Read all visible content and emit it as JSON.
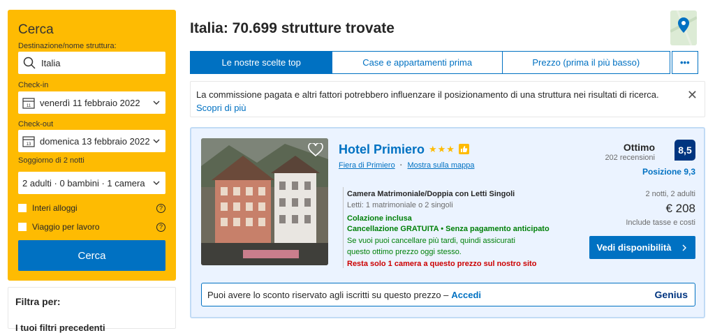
{
  "search": {
    "title": "Cerca",
    "dest_label": "Destinazione/nome struttura:",
    "dest_value": "Italia",
    "checkin_label": "Check-in",
    "checkin_value": "venerdì 11 febbraio 2022",
    "checkin_day": "11",
    "checkout_label": "Check-out",
    "checkout_value": "domenica 13 febbraio 2022",
    "checkout_day": "13",
    "nights_label": "Soggiorno di 2 notti",
    "guests_value": "2 adulti · 0 bambini · 1 camera",
    "opt_entire": "Interi alloggi",
    "opt_business": "Viaggio per lavoro",
    "button": "Cerca"
  },
  "filters": {
    "title": "Filtra per:",
    "subtitle": "I tuoi filtri precedenti"
  },
  "results": {
    "title": "Italia: 70.699 strutture trovate"
  },
  "sort_tabs": [
    {
      "label": "Le nostre scelte top"
    },
    {
      "label": "Case e appartamenti prima"
    },
    {
      "label": "Prezzo (prima il più basso)"
    },
    {
      "label": "•••"
    }
  ],
  "notice": {
    "text": "La commissione pagata e altri fattori potrebbero influenzare il posizionamento di una struttura nei risultati di ricerca.",
    "link": "Scopri di più",
    "close": "✕"
  },
  "hotel": {
    "name": "Hotel Primiero",
    "stars": "★★★",
    "location": "Fiera di Primiero",
    "sep": "·",
    "map_link": "Mostra sulla mappa",
    "rating_word": "Ottimo",
    "reviews": "202 recensioni",
    "score": "8,5",
    "position": "Posizione 9,3",
    "room": "Camera Matrimoniale/Doppia con Letti Singoli",
    "beds": "Letti: 1 matrimoniale o 2 singoli",
    "breakfast": "Colazione inclusa",
    "cancel": "Cancellazione GRATUITA • Senza pagamento anticipato",
    "cancel_note": "Se vuoi puoi cancellare più tardi, quindi assicurati questo ottimo prezzo oggi stesso.",
    "scarcity": "Resta solo 1 camera a questo prezzo sul nostro sito",
    "stay": "2 notti, 2 adulti",
    "price": "€ 208",
    "taxes": "Include tasse e costi",
    "cta": "Vedi disponibilità",
    "genius_text": "Puoi avere lo sconto riservato agli iscritti su questo prezzo –",
    "genius_link": "Accedi",
    "genius_brand": "Genius"
  },
  "colors": {
    "brand_blue": "#0071c2",
    "dark_blue": "#003580",
    "yellow": "#febb02",
    "green": "#008009",
    "red": "#cc0000"
  }
}
